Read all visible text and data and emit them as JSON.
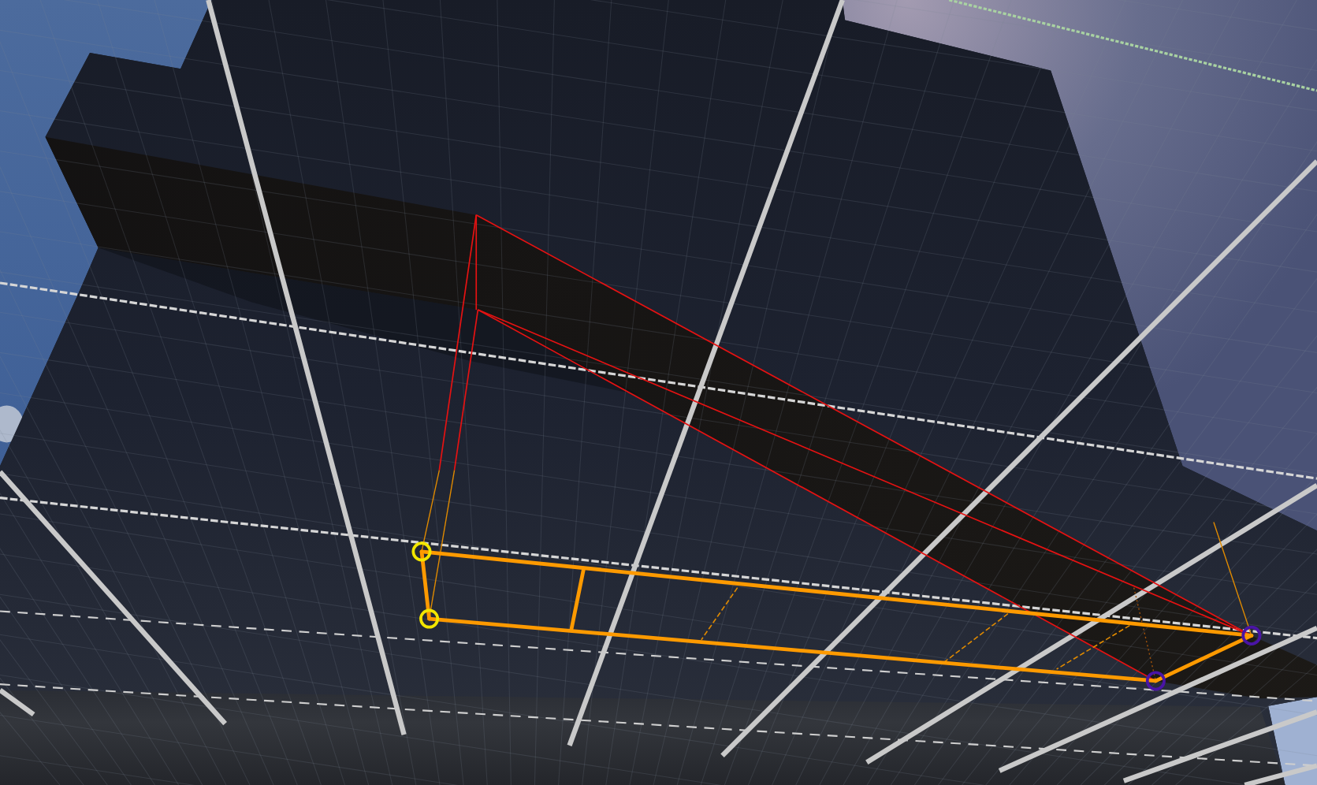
{
  "viewport": {
    "spline_points": [
      {
        "color": "#f2e600"
      },
      {
        "color": "#f2e600"
      },
      {
        "color": "#4a14a6"
      },
      {
        "color": "#4a14a6"
      }
    ]
  }
}
